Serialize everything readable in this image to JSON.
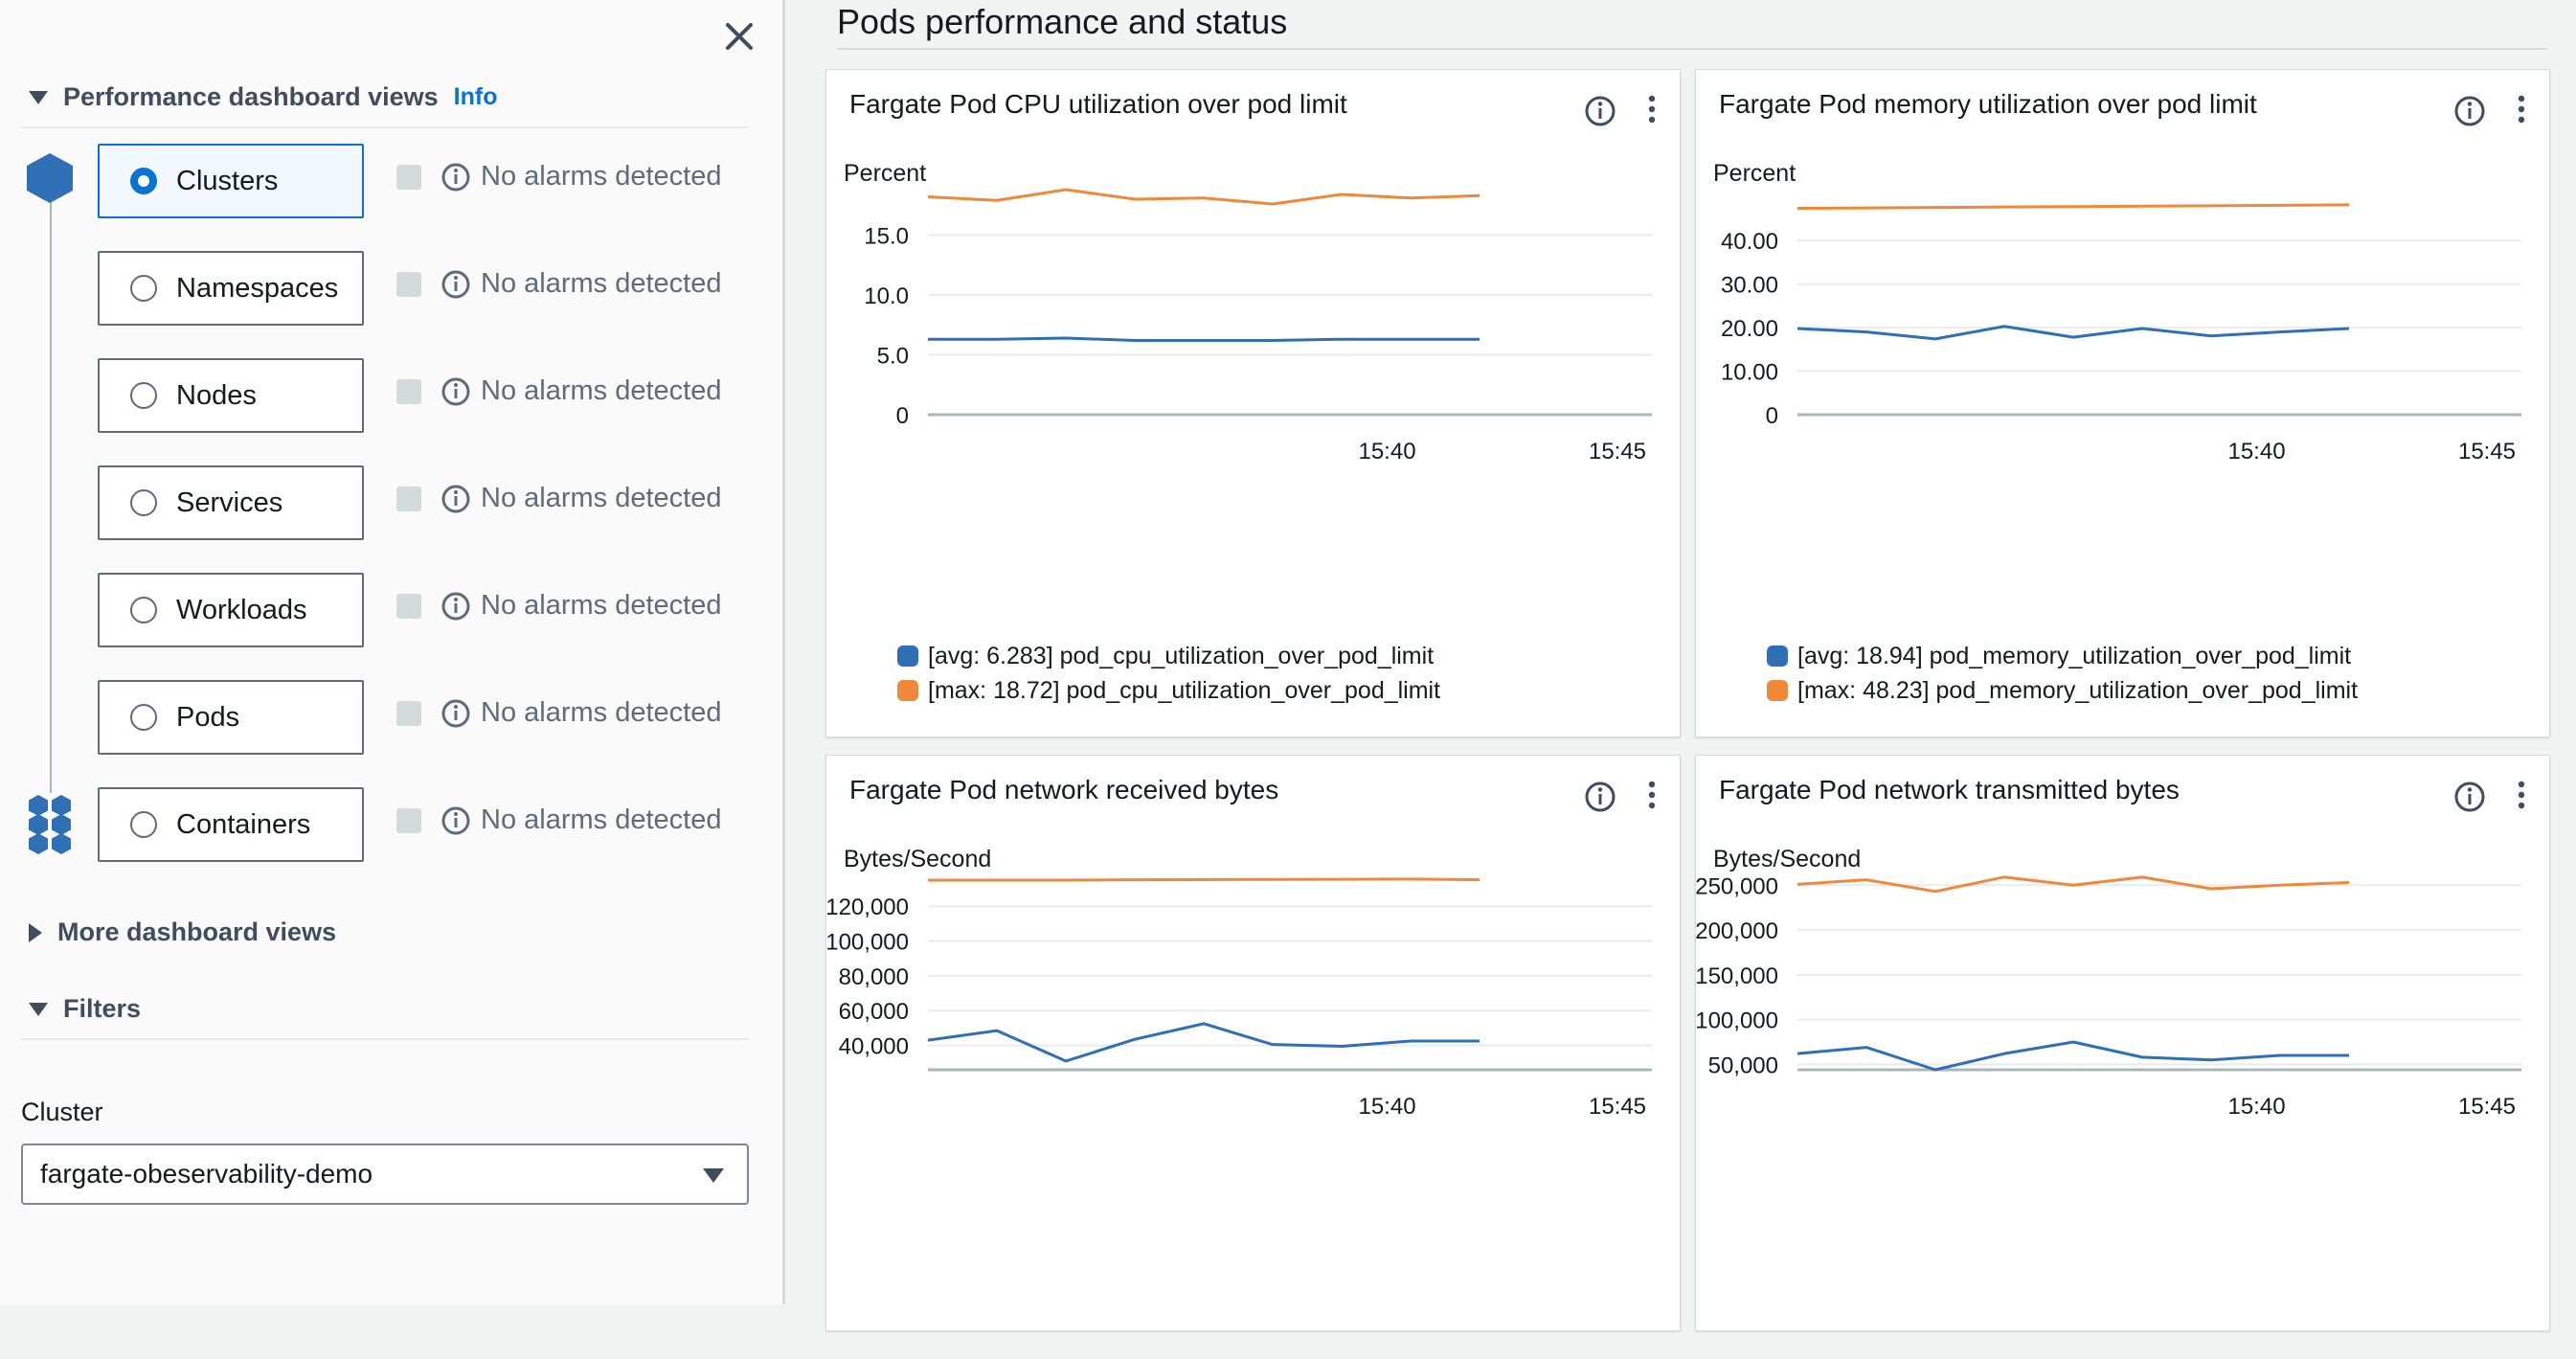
{
  "left_panel": {
    "perf_header": "Performance dashboard views",
    "info_link": "Info",
    "views": [
      {
        "label": "Clusters",
        "selected": true,
        "alarm": "No alarms detected"
      },
      {
        "label": "Namespaces",
        "selected": false,
        "alarm": "No alarms detected"
      },
      {
        "label": "Nodes",
        "selected": false,
        "alarm": "No alarms detected"
      },
      {
        "label": "Services",
        "selected": false,
        "alarm": "No alarms detected"
      },
      {
        "label": "Workloads",
        "selected": false,
        "alarm": "No alarms detected"
      },
      {
        "label": "Pods",
        "selected": false,
        "alarm": "No alarms detected"
      },
      {
        "label": "Containers",
        "selected": false,
        "alarm": "No alarms detected"
      }
    ],
    "more_views": "More dashboard views",
    "filters_header": "Filters",
    "cluster_label": "Cluster",
    "cluster_value": "fargate-obeservability-demo"
  },
  "main": {
    "title": "Pods performance and status"
  },
  "colors": {
    "avg": "#2f6fb6",
    "max": "#f0883a",
    "accent": "#0972d3",
    "hex_icon": "#2f6fb6"
  },
  "widgets": [
    {
      "title": "Fargate Pod CPU utilization over pod limit",
      "unit": "Percent",
      "legend": [
        "[avg: 6.283] pod_cpu_utilization_over_pod_limit",
        "[max: 18.72] pod_cpu_utilization_over_pod_limit"
      ]
    },
    {
      "title": "Fargate Pod memory utilization over pod limit",
      "unit": "Percent",
      "legend": [
        "[avg: 18.94] pod_memory_utilization_over_pod_limit",
        "[max: 48.23] pod_memory_utilization_over_pod_limit"
      ]
    },
    {
      "title": "Fargate Pod network received bytes",
      "unit": "Bytes/Second",
      "legend": []
    },
    {
      "title": "Fargate Pod network transmitted bytes",
      "unit": "Bytes/Second",
      "legend": []
    }
  ],
  "chart_data": [
    {
      "type": "line",
      "title": "Fargate Pod CPU utilization over pod limit",
      "ylabel": "Percent",
      "ylim": [
        0,
        20
      ],
      "yticks": [
        "0",
        "5.0",
        "10.0",
        "15.0"
      ],
      "ytick_values": [
        0,
        5,
        10,
        15
      ],
      "xlim": [
        0,
        5
      ],
      "xticks": [
        "15:40",
        "15:45"
      ],
      "xtick_values": [
        3.33,
        5
      ],
      "x": [
        0,
        0.5,
        1,
        1.5,
        2,
        2.5,
        3,
        3.5,
        4
      ],
      "grid": true,
      "series": [
        {
          "name": "[avg: 6.283] pod_cpu_utilization_over_pod_limit",
          "color": "#2f6fb6",
          "values": [
            6.3,
            6.3,
            6.4,
            6.2,
            6.2,
            6.2,
            6.3,
            6.3,
            6.3
          ]
        },
        {
          "name": "[max: 18.72] pod_cpu_utilization_over_pod_limit",
          "color": "#f0883a",
          "values": [
            18.2,
            17.9,
            18.8,
            18.0,
            18.1,
            17.6,
            18.4,
            18.1,
            18.3
          ]
        }
      ]
    },
    {
      "type": "line",
      "title": "Fargate Pod memory utilization over pod limit",
      "ylabel": "Percent",
      "ylim": [
        0,
        55
      ],
      "yticks": [
        "0",
        "10.00",
        "20.00",
        "30.00",
        "40.00"
      ],
      "ytick_values": [
        0,
        10,
        20,
        30,
        40
      ],
      "xlim": [
        0,
        5
      ],
      "xticks": [
        "15:40",
        "15:45"
      ],
      "xtick_values": [
        3.33,
        5
      ],
      "x": [
        0,
        0.5,
        1,
        1.5,
        2,
        2.5,
        3,
        3.5,
        4
      ],
      "grid": true,
      "series": [
        {
          "name": "[avg: 18.94] pod_memory_utilization_over_pod_limit",
          "color": "#2f6fb6",
          "values": [
            19.8,
            19.0,
            17.4,
            20.3,
            17.8,
            19.8,
            18.1,
            19.0,
            19.8
          ]
        },
        {
          "name": "[max: 48.23] pod_memory_utilization_over_pod_limit",
          "color": "#f0883a",
          "values": [
            47.4,
            47.5,
            47.6,
            47.7,
            47.8,
            47.9,
            48.0,
            48.1,
            48.2
          ]
        }
      ]
    },
    {
      "type": "line",
      "title": "Fargate Pod network received bytes",
      "ylabel": "Bytes/Second",
      "ylim": [
        26000,
        146000
      ],
      "yticks": [
        "40,000",
        "60,000",
        "80,000",
        "100,000",
        "120,000"
      ],
      "ytick_values": [
        40000,
        60000,
        80000,
        100000,
        120000
      ],
      "xlim": [
        0,
        5
      ],
      "xticks": [
        "15:40",
        "15:45"
      ],
      "xtick_values": [
        3.33,
        5
      ],
      "x": [
        0,
        0.5,
        1,
        1.5,
        2,
        2.5,
        3,
        3.5,
        4
      ],
      "grid": true,
      "series": [
        {
          "color": "#2f6fb6",
          "values": [
            43000,
            48500,
            31000,
            43500,
            52500,
            40500,
            39500,
            42500,
            42500
          ]
        },
        {
          "color": "#f0883a",
          "values": [
            135000,
            135000,
            135000,
            135200,
            135300,
            135400,
            135500,
            135600,
            135200
          ]
        }
      ]
    },
    {
      "type": "line",
      "title": "Fargate Pod network transmitted bytes",
      "ylabel": "Bytes/Second",
      "ylim": [
        44000,
        277000
      ],
      "yticks": [
        "50,000",
        "100,000",
        "150,000",
        "200,000",
        "250,000"
      ],
      "ytick_values": [
        50000,
        100000,
        150000,
        200000,
        250000
      ],
      "xlim": [
        0,
        5
      ],
      "xticks": [
        "15:40",
        "15:45"
      ],
      "xtick_values": [
        3.33,
        5
      ],
      "x": [
        0,
        0.5,
        1,
        1.5,
        2,
        2.5,
        3,
        3.5,
        4
      ],
      "grid": true,
      "series": [
        {
          "color": "#2f6fb6",
          "values": [
            62000,
            69000,
            44000,
            62000,
            75000,
            58000,
            55000,
            60000,
            60000
          ]
        },
        {
          "color": "#f0883a",
          "values": [
            251000,
            256000,
            243000,
            259000,
            250000,
            259000,
            246000,
            250000,
            253000
          ]
        }
      ]
    }
  ]
}
